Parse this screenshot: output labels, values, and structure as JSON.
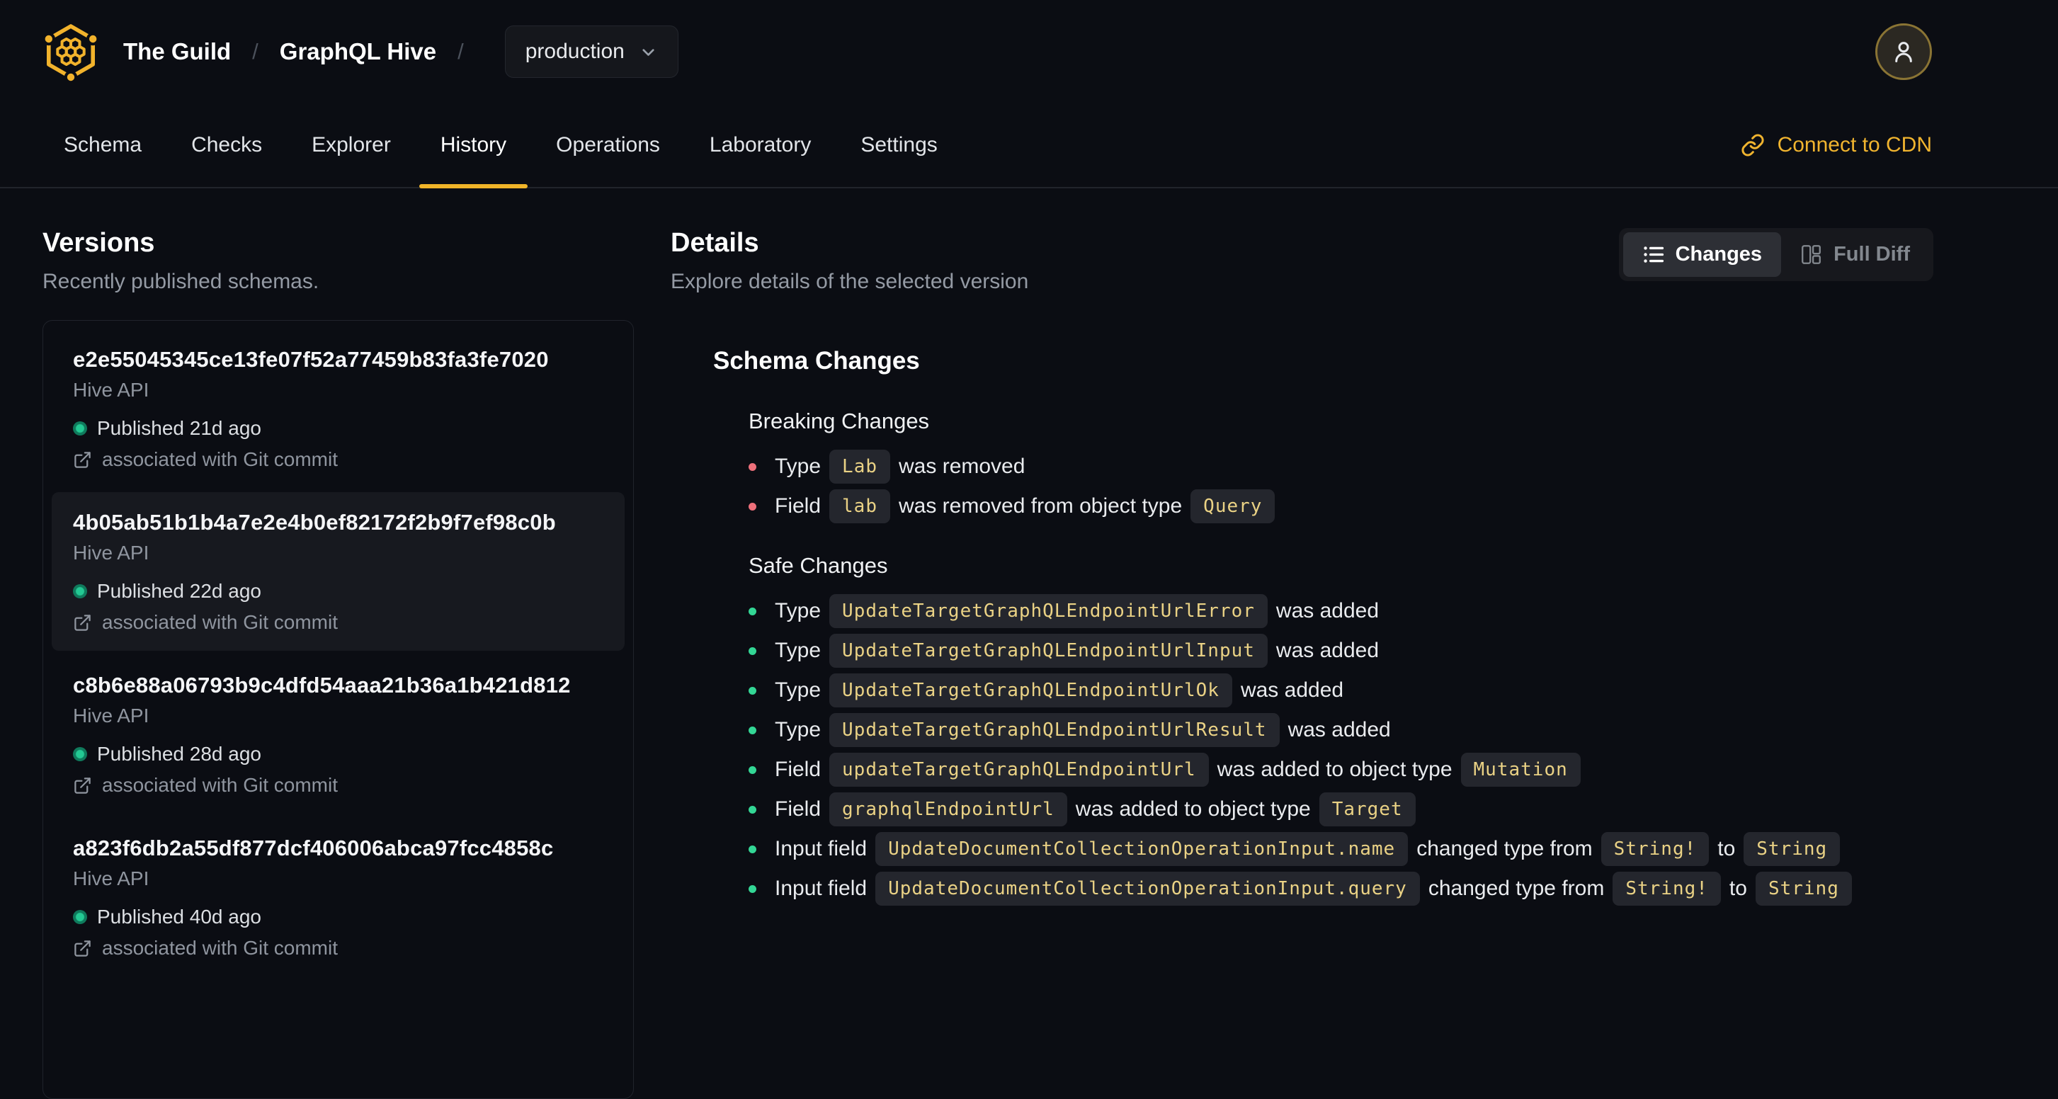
{
  "colors": {
    "accent_yellow": "#f0b429",
    "chip_text": "#ead285",
    "chip_bg": "#24262d",
    "breaking_bullet": "#ee707b",
    "safe_bullet": "#33d695",
    "published_dot": "#23c993",
    "page_bg": "#0b0d13",
    "selected_card_bg": "#17191f"
  },
  "header": {
    "org": "The Guild",
    "separator": "/",
    "project": "GraphQL Hive",
    "target_selector": {
      "value": "production"
    },
    "icons": {
      "logo": "hive-honeycomb-logo",
      "user": "person-icon",
      "chevron": "chevron-down-icon"
    }
  },
  "nav": {
    "tabs": [
      {
        "label": "Schema",
        "active": false
      },
      {
        "label": "Checks",
        "active": false
      },
      {
        "label": "Explorer",
        "active": false
      },
      {
        "label": "History",
        "active": true
      },
      {
        "label": "Operations",
        "active": false
      },
      {
        "label": "Laboratory",
        "active": false
      },
      {
        "label": "Settings",
        "active": false
      }
    ],
    "cdn_link": "Connect to CDN"
  },
  "versions": {
    "title": "Versions",
    "subtitle": "Recently published schemas.",
    "items": [
      {
        "hash": "e2e55045345ce13fe07f52a77459b83fa3fe7020",
        "service": "Hive API",
        "published": "Published 21d ago",
        "git_note": "associated with Git commit",
        "selected": false
      },
      {
        "hash": "4b05ab51b1b4a7e2e4b0ef82172f2b9f7ef98c0b",
        "service": "Hive API",
        "published": "Published 22d ago",
        "git_note": "associated with Git commit",
        "selected": true
      },
      {
        "hash": "c8b6e88a06793b9c4dfd54aaa21b36a1b421d812",
        "service": "Hive API",
        "published": "Published 28d ago",
        "git_note": "associated with Git commit",
        "selected": false
      },
      {
        "hash": "a823f6db2a55df877dcf406006abca97fcc4858c",
        "service": "Hive API",
        "published": "Published 40d ago",
        "git_note": "associated with Git commit",
        "selected": false
      }
    ]
  },
  "details": {
    "title": "Details",
    "subtitle": "Explore details of the selected version",
    "view_toggle": [
      {
        "label": "Changes",
        "active": true,
        "icon": "list-icon"
      },
      {
        "label": "Full Diff",
        "active": false,
        "icon": "columns-icon"
      }
    ],
    "schema_changes": {
      "title": "Schema Changes",
      "groups": [
        {
          "title": "Breaking Changes",
          "severity": "breaking",
          "items": [
            [
              {
                "t": "text",
                "v": "Type"
              },
              {
                "t": "code",
                "v": "Lab"
              },
              {
                "t": "text",
                "v": "was removed"
              }
            ],
            [
              {
                "t": "text",
                "v": "Field"
              },
              {
                "t": "code",
                "v": "lab"
              },
              {
                "t": "text",
                "v": "was removed from object type"
              },
              {
                "t": "code",
                "v": "Query"
              }
            ]
          ]
        },
        {
          "title": "Safe Changes",
          "severity": "safe",
          "items": [
            [
              {
                "t": "text",
                "v": "Type"
              },
              {
                "t": "code",
                "v": "UpdateTargetGraphQLEndpointUrlError"
              },
              {
                "t": "text",
                "v": "was added"
              }
            ],
            [
              {
                "t": "text",
                "v": "Type"
              },
              {
                "t": "code",
                "v": "UpdateTargetGraphQLEndpointUrlInput"
              },
              {
                "t": "text",
                "v": "was added"
              }
            ],
            [
              {
                "t": "text",
                "v": "Type"
              },
              {
                "t": "code",
                "v": "UpdateTargetGraphQLEndpointUrlOk"
              },
              {
                "t": "text",
                "v": "was added"
              }
            ],
            [
              {
                "t": "text",
                "v": "Type"
              },
              {
                "t": "code",
                "v": "UpdateTargetGraphQLEndpointUrlResult"
              },
              {
                "t": "text",
                "v": "was added"
              }
            ],
            [
              {
                "t": "text",
                "v": "Field"
              },
              {
                "t": "code",
                "v": "updateTargetGraphQLEndpointUrl"
              },
              {
                "t": "text",
                "v": "was added to object type"
              },
              {
                "t": "code",
                "v": "Mutation"
              }
            ],
            [
              {
                "t": "text",
                "v": "Field"
              },
              {
                "t": "code",
                "v": "graphqlEndpointUrl"
              },
              {
                "t": "text",
                "v": "was added to object type"
              },
              {
                "t": "code",
                "v": "Target"
              }
            ],
            [
              {
                "t": "text",
                "v": "Input field"
              },
              {
                "t": "code",
                "v": "UpdateDocumentCollectionOperationInput.name"
              },
              {
                "t": "text",
                "v": "changed type from"
              },
              {
                "t": "code",
                "v": "String!"
              },
              {
                "t": "text",
                "v": "to"
              },
              {
                "t": "code",
                "v": "String"
              }
            ],
            [
              {
                "t": "text",
                "v": "Input field"
              },
              {
                "t": "code",
                "v": "UpdateDocumentCollectionOperationInput.query"
              },
              {
                "t": "text",
                "v": "changed type from"
              },
              {
                "t": "code",
                "v": "String!"
              },
              {
                "t": "text",
                "v": "to"
              },
              {
                "t": "code",
                "v": "String"
              }
            ]
          ]
        }
      ]
    }
  }
}
